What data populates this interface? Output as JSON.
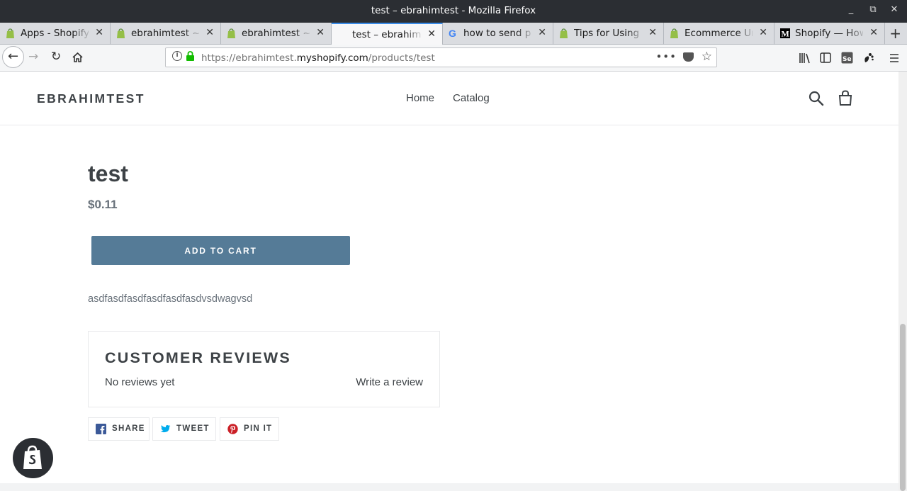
{
  "window": {
    "title": "test – ebrahimtest - Mozilla Firefox"
  },
  "tabs": [
    {
      "label": "Apps - Shopify Partners",
      "favicon": "shopify-icon"
    },
    {
      "label": "ebrahimtest ~ Customers",
      "favicon": "shopify-icon"
    },
    {
      "label": "ebrahimtest ~ Edit",
      "favicon": "shopify-icon"
    },
    {
      "label": "test – ebrahimtest",
      "favicon": "none",
      "active": true
    },
    {
      "label": "how to send pages",
      "favicon": "google-icon"
    },
    {
      "label": "Tips for Using Shopify",
      "favicon": "shopify-icon"
    },
    {
      "label": "Ecommerce University",
      "favicon": "shopify-icon"
    },
    {
      "label": "Shopify — How",
      "favicon": "medium-icon"
    }
  ],
  "urlbar": {
    "prefix": "https://ebrahimtest.",
    "domain": "myshopify.com",
    "path": "/products/test",
    "more": "•••"
  },
  "store": {
    "name": "EBRAHIMTEST",
    "nav": [
      "Home",
      "Catalog"
    ]
  },
  "product": {
    "title": "test",
    "price": "$0.11",
    "add_to_cart": "ADD TO CART",
    "description": "asdfasdfasdfasdfasdfasdvsdwagvsd"
  },
  "reviews": {
    "heading": "CUSTOMER REVIEWS",
    "empty": "No reviews yet",
    "write": "Write a review"
  },
  "share": {
    "facebook": "SHARE",
    "twitter": "TWEET",
    "pinterest": "PIN IT"
  },
  "colors": {
    "accent": "#557b97",
    "facebook": "#3b5998",
    "twitter": "#00aced",
    "pinterest": "#cb2027",
    "titlebar": "#2b2e33"
  }
}
